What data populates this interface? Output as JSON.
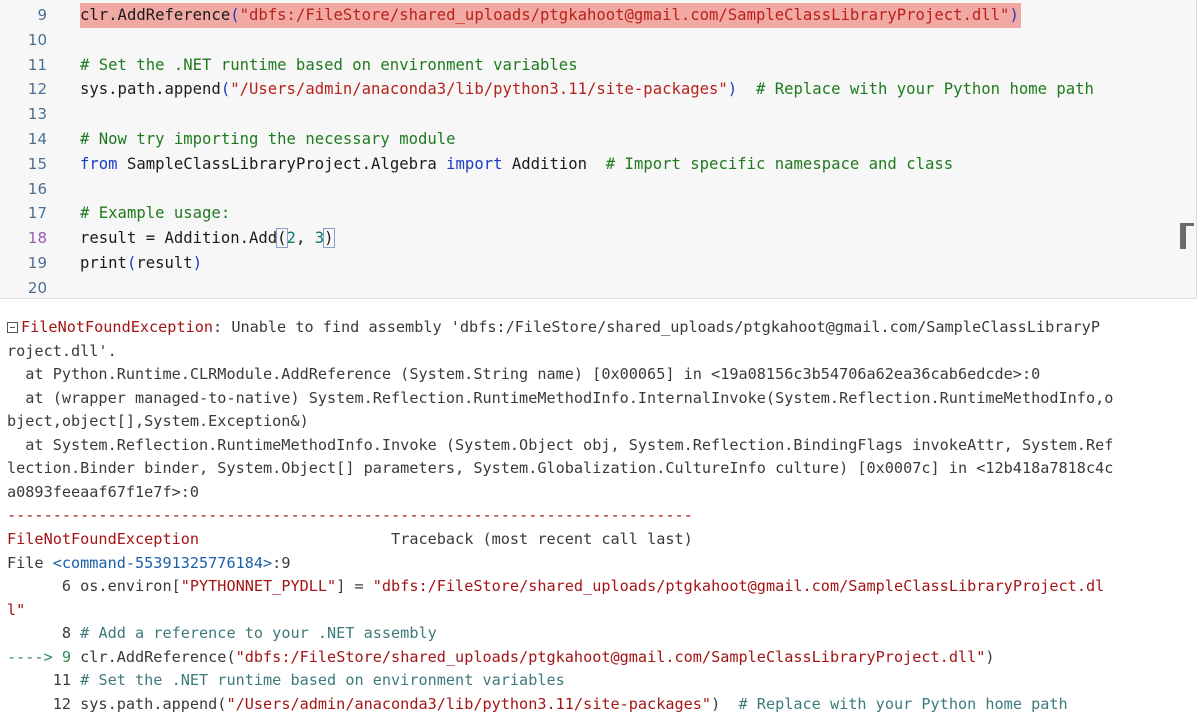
{
  "editor": {
    "lines": [
      {
        "num": "9",
        "segments": [
          [
            "plain",
            "clr.AddReference"
          ],
          [
            "punc",
            "("
          ],
          [
            "str",
            "\"dbfs:/FileStore/shared_uploads/ptgkahoot@gmail.com/SampleClassLibraryProject.dll\""
          ],
          [
            "punc",
            ")"
          ]
        ],
        "highlight": true
      },
      {
        "num": "10",
        "segments": []
      },
      {
        "num": "11",
        "segments": [
          [
            "cmt",
            "# Set the .NET runtime based on environment variables"
          ]
        ]
      },
      {
        "num": "12",
        "segments": [
          [
            "plain",
            "sys.path.append"
          ],
          [
            "punc",
            "("
          ],
          [
            "str",
            "\"/Users/admin/anaconda3/lib/python3.11/site-packages\""
          ],
          [
            "punc",
            ")"
          ],
          [
            "plain",
            "  "
          ],
          [
            "cmt",
            "# Replace with your Python home path"
          ]
        ]
      },
      {
        "num": "13",
        "segments": []
      },
      {
        "num": "14",
        "segments": [
          [
            "cmt",
            "# Now try importing the necessary module"
          ]
        ]
      },
      {
        "num": "15",
        "segments": [
          [
            "kw",
            "from"
          ],
          [
            "plain",
            " SampleClassLibraryProject.Algebra "
          ],
          [
            "kw",
            "import"
          ],
          [
            "plain",
            " Addition  "
          ],
          [
            "cmt",
            "# Import specific namespace and class"
          ]
        ]
      },
      {
        "num": "16",
        "segments": []
      },
      {
        "num": "17",
        "segments": [
          [
            "cmt",
            "# Example usage:"
          ]
        ]
      },
      {
        "num": "18",
        "segments": [
          [
            "plain",
            "result = Addition.Add"
          ],
          [
            "pbox",
            "("
          ],
          [
            "num",
            "2"
          ],
          [
            "plain",
            ", "
          ],
          [
            "num",
            "3"
          ],
          [
            "pbox",
            ")"
          ]
        ],
        "active": true
      },
      {
        "num": "19",
        "segments": [
          [
            "plain",
            "print"
          ],
          [
            "punc",
            "("
          ],
          [
            "plain",
            "result"
          ],
          [
            "punc",
            ")"
          ]
        ]
      },
      {
        "num": "20",
        "segments": []
      }
    ]
  },
  "output": {
    "lines": [
      [
        [
          "icon",
          "collapse"
        ],
        [
          "red",
          "FileNotFoundException"
        ],
        [
          "plain",
          ": Unable to find assembly 'dbfs:/FileStore/shared_uploads/ptgkahoot@gmail.com/SampleClassLibraryP"
        ]
      ],
      [
        [
          "plain",
          "roject.dll'."
        ]
      ],
      [
        [
          "plain",
          "  at Python.Runtime.CLRModule.AddReference (System.String name) [0x00065] in <19a08156c3b54706a62ea36cab6edcde>:0"
        ]
      ],
      [
        [
          "plain",
          "  at (wrapper managed-to-native) System.Reflection.RuntimeMethodInfo.InternalInvoke(System.Reflection.RuntimeMethodInfo,o"
        ]
      ],
      [
        [
          "plain",
          "bject,object[],System.Exception&)"
        ]
      ],
      [
        [
          "plain",
          "  at System.Reflection.RuntimeMethodInfo.Invoke (System.Object obj, System.Reflection.BindingFlags invokeAttr, System.Ref"
        ]
      ],
      [
        [
          "plain",
          "lection.Binder binder, System.Object[] parameters, System.Globalization.CultureInfo culture) [0x0007c] in <12b418a7818c4c"
        ]
      ],
      [
        [
          "plain",
          "a0893feeaaf67f1e7f>:0"
        ]
      ],
      [
        [
          "red",
          "---------------------------------------------------------------------------"
        ]
      ],
      [
        [
          "red",
          "FileNotFoundException"
        ],
        [
          "plain",
          "                     Traceback (most recent call last)"
        ]
      ],
      [
        [
          "plain",
          "File "
        ],
        [
          "blue",
          "<command-55391325776184>"
        ],
        [
          "plain",
          ":9"
        ]
      ],
      [
        [
          "plain",
          "      6 os.environ["
        ],
        [
          "red",
          "\"PYTHONNET_PYDLL\""
        ],
        [
          "plain",
          "] = "
        ],
        [
          "red",
          "\"dbfs:/FileStore/shared_uploads/ptgkahoot@gmail.com/SampleClassLibraryProject.dl"
        ]
      ],
      [
        [
          "red",
          "l\""
        ]
      ],
      [
        [
          "plain",
          "      8 "
        ],
        [
          "cmt",
          "# Add a reference to your .NET assembly"
        ]
      ],
      [
        [
          "green",
          "----> 9 "
        ],
        [
          "plain",
          "clr.AddReference("
        ],
        [
          "red",
          "\"dbfs:/FileStore/shared_uploads/ptgkahoot@gmail.com/SampleClassLibraryProject.dll\""
        ],
        [
          "plain",
          ")"
        ]
      ],
      [
        [
          "plain",
          "     11 "
        ],
        [
          "cmt",
          "# Set the .NET runtime based on environment variables"
        ]
      ],
      [
        [
          "plain",
          "     12 sys.path.append("
        ],
        [
          "red",
          "\"/Users/admin/anaconda3/lib/python3.11/site-packages\""
        ],
        [
          "plain",
          ")  "
        ],
        [
          "cmt",
          "# Replace with your Python home path"
        ]
      ]
    ]
  }
}
